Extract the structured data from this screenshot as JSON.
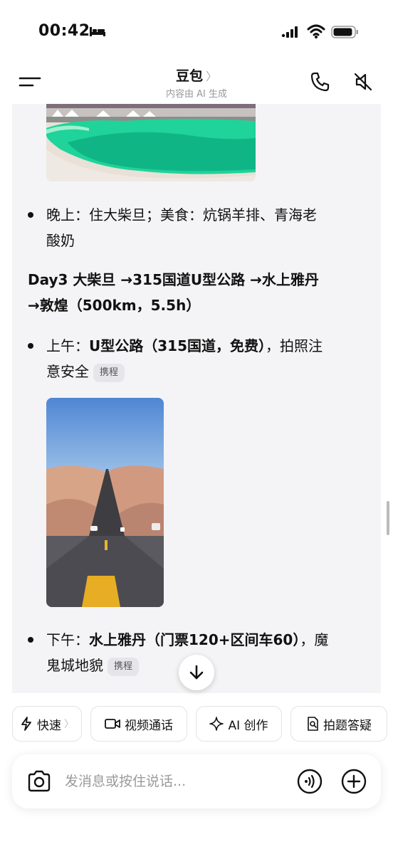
{
  "status_bar": {
    "time": "00:42"
  },
  "header": {
    "title": "豆包",
    "title_chevron": "〉",
    "subtitle": "内容由 AI 生成"
  },
  "messages": {
    "evening": {
      "label": "晚上：",
      "text": "住大柴旦；美食：炕锅羊排、青海老",
      "text2": "酸奶"
    },
    "day3": {
      "line1": "Day3 大柴旦 →315国道U型公路 →水上雅丹",
      "line2": "→敦煌（500km，5.5h）"
    },
    "morning": {
      "label": "上午：",
      "bold": "U型公路（315国道，免费）",
      "text": "，拍照注",
      "text2": "意安全",
      "tag": "携程"
    },
    "afternoon": {
      "label": "下午：",
      "bold": "水上雅丹（门票120+区间车60）",
      "text": "，魔",
      "text2": "鬼城地貌",
      "tag": "携程"
    }
  },
  "chips": [
    {
      "label": "快速",
      "icon": "lightning-icon",
      "chevron": "〉"
    },
    {
      "label": "视频通话",
      "icon": "video-icon"
    },
    {
      "label": "AI 创作",
      "icon": "sparkle-icon"
    },
    {
      "label": "拍题答疑",
      "icon": "document-search-icon"
    }
  ],
  "input": {
    "placeholder": "发消息或按住说话..."
  },
  "colors": {
    "card_bg": "#f4f4f6",
    "lake": "#1fd39a",
    "sky": "#5b92d8",
    "sand": "#d9a58a"
  }
}
